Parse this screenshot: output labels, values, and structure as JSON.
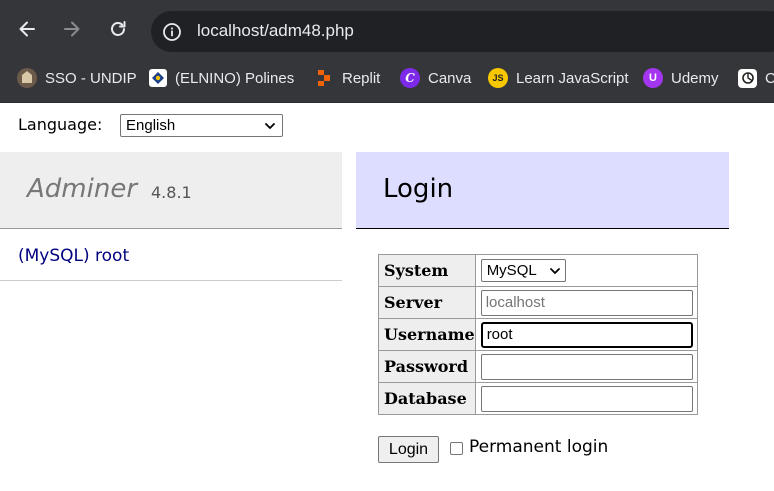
{
  "browser": {
    "url": "localhost/adm48.php",
    "icons": {
      "back": "arrow-left-icon",
      "forward": "arrow-right-icon",
      "reload": "reload-icon",
      "site_info": "info-circle-icon"
    }
  },
  "bookmarks": [
    {
      "label": "SSO - UNDIP",
      "icon": "undip-logo-icon"
    },
    {
      "label": "(ELNINO) Polines",
      "icon": "polines-logo-icon"
    },
    {
      "label": "Replit",
      "icon": "replit-logo-icon"
    },
    {
      "label": "Canva",
      "icon": "canva-logo-icon"
    },
    {
      "label": "Learn JavaScript",
      "icon": "javascript-logo-icon"
    },
    {
      "label": "Udemy",
      "icon": "udemy-logo-icon"
    },
    {
      "label": "C",
      "icon": "chatgpt-logo-icon"
    }
  ],
  "page": {
    "language_label": "Language:",
    "language_value": "English",
    "brand": "Adminer",
    "version": "4.8.1",
    "menu_link": "(MySQL) root",
    "title": "Login",
    "form": {
      "system_label": "System",
      "system_value": "MySQL",
      "server_label": "Server",
      "server_placeholder": "localhost",
      "username_label": "Username",
      "username_value": "root",
      "password_label": "Password",
      "password_value": "",
      "database_label": "Database",
      "database_value": ""
    },
    "login_button": "Login",
    "permanent_login_label": "Permanent login"
  },
  "colors": {
    "chrome_bg": "#35363a",
    "omnibox_bg": "#202124",
    "menu_head_bg": "#eeeeee",
    "content_head_bg": "#ddddff",
    "link": "#000080"
  }
}
